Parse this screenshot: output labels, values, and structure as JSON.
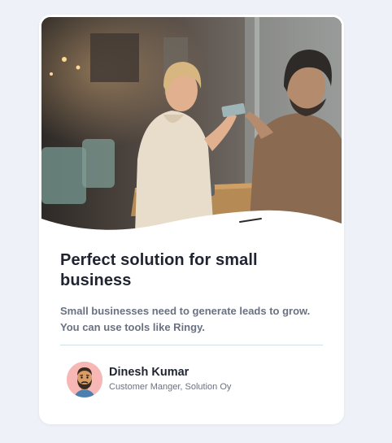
{
  "card": {
    "image_alt": "Woman smiling and handing a card to a man across a cafe table",
    "title": "Perfect solution for small business",
    "description": "Small businesses need to generate leads to grow. You can use tools like Ringy.",
    "author": {
      "name": "Dinesh Kumar",
      "role": "Customer Manger, Solution Oy",
      "avatar_icon": "bearded-man-avatar-icon"
    }
  },
  "colors": {
    "page_background": "#eef1f7",
    "card_background": "#ffffff",
    "title_text": "#1f2430",
    "body_text": "#6a7180",
    "divider": "#cfe1e3",
    "avatar_background": "#f7b8b5"
  }
}
